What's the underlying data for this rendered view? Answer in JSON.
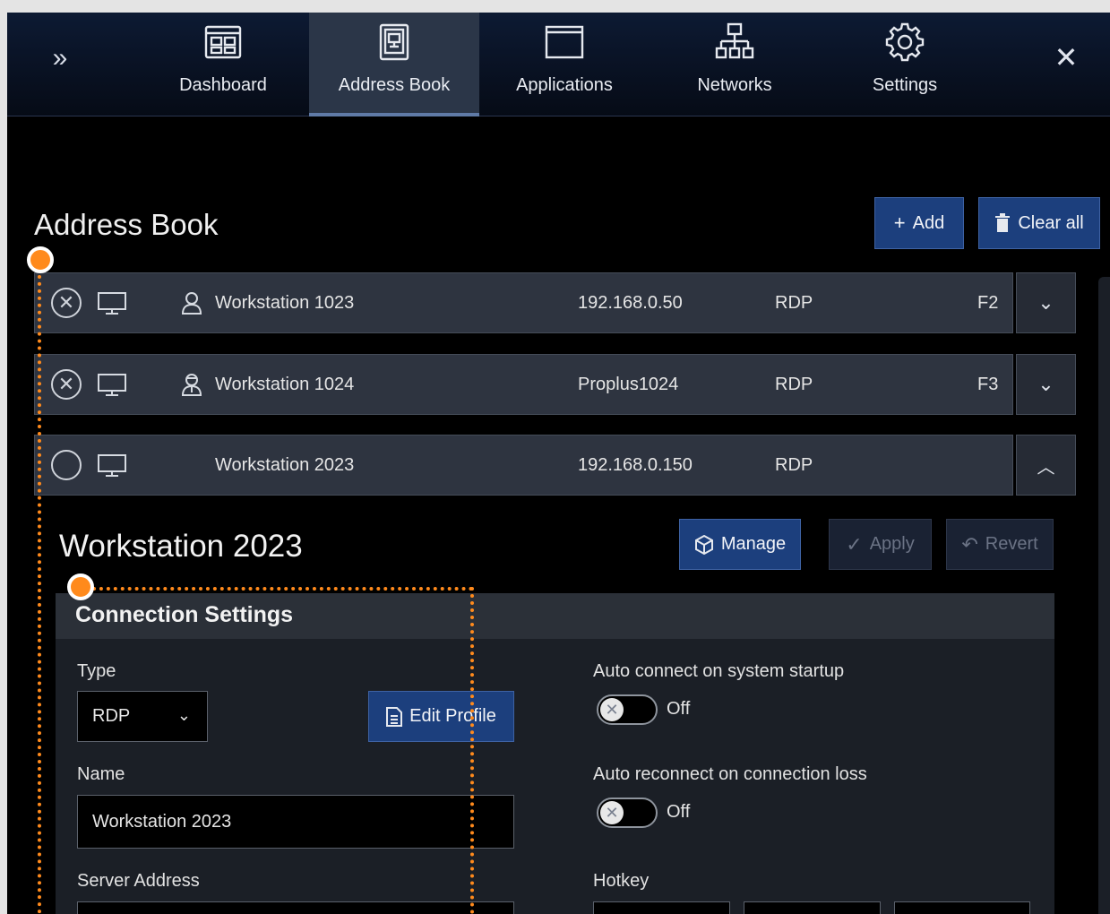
{
  "nav": {
    "expand_icon": "double-chevron-right",
    "close_icon": "close-x",
    "tabs": [
      {
        "label": "Dashboard",
        "icon": "dashboard-icon",
        "active": false
      },
      {
        "label": "Address Book",
        "icon": "address-book-icon",
        "active": true
      },
      {
        "label": "Applications",
        "icon": "window-icon",
        "active": false
      },
      {
        "label": "Networks",
        "icon": "network-icon",
        "active": false
      },
      {
        "label": "Settings",
        "icon": "gear-icon",
        "active": false
      }
    ]
  },
  "address_book": {
    "title": "Address Book",
    "add_label": "Add",
    "clear_label": "Clear all",
    "entries": [
      {
        "name": "Workstation 1023",
        "address": "192.168.0.50",
        "protocol": "RDP",
        "hotkey": "F2",
        "expanded": false
      },
      {
        "name": "Workstation 1024",
        "address": "Proplus1024",
        "protocol": "RDP",
        "hotkey": "F3",
        "expanded": false
      },
      {
        "name": "Workstation 2023",
        "address": "192.168.0.150",
        "protocol": "RDP",
        "hotkey": "",
        "expanded": true
      }
    ]
  },
  "detail": {
    "title": "Workstation 2023",
    "manage_label": "Manage",
    "apply_label": "Apply",
    "revert_label": "Revert",
    "section_title": "Connection Settings",
    "type_label": "Type",
    "type_value": "RDP",
    "edit_profile_label": "Edit Profile",
    "name_label": "Name",
    "name_value": "Workstation 2023",
    "server_address_label": "Server Address",
    "auto_connect_label": "Auto connect on system startup",
    "auto_connect_state": "Off",
    "auto_reconnect_label": "Auto reconnect on connection loss",
    "auto_reconnect_state": "Off",
    "hotkey_label": "Hotkey"
  },
  "colors": {
    "accent": "#1c3f7d",
    "highlight": "#ff8a1c"
  }
}
